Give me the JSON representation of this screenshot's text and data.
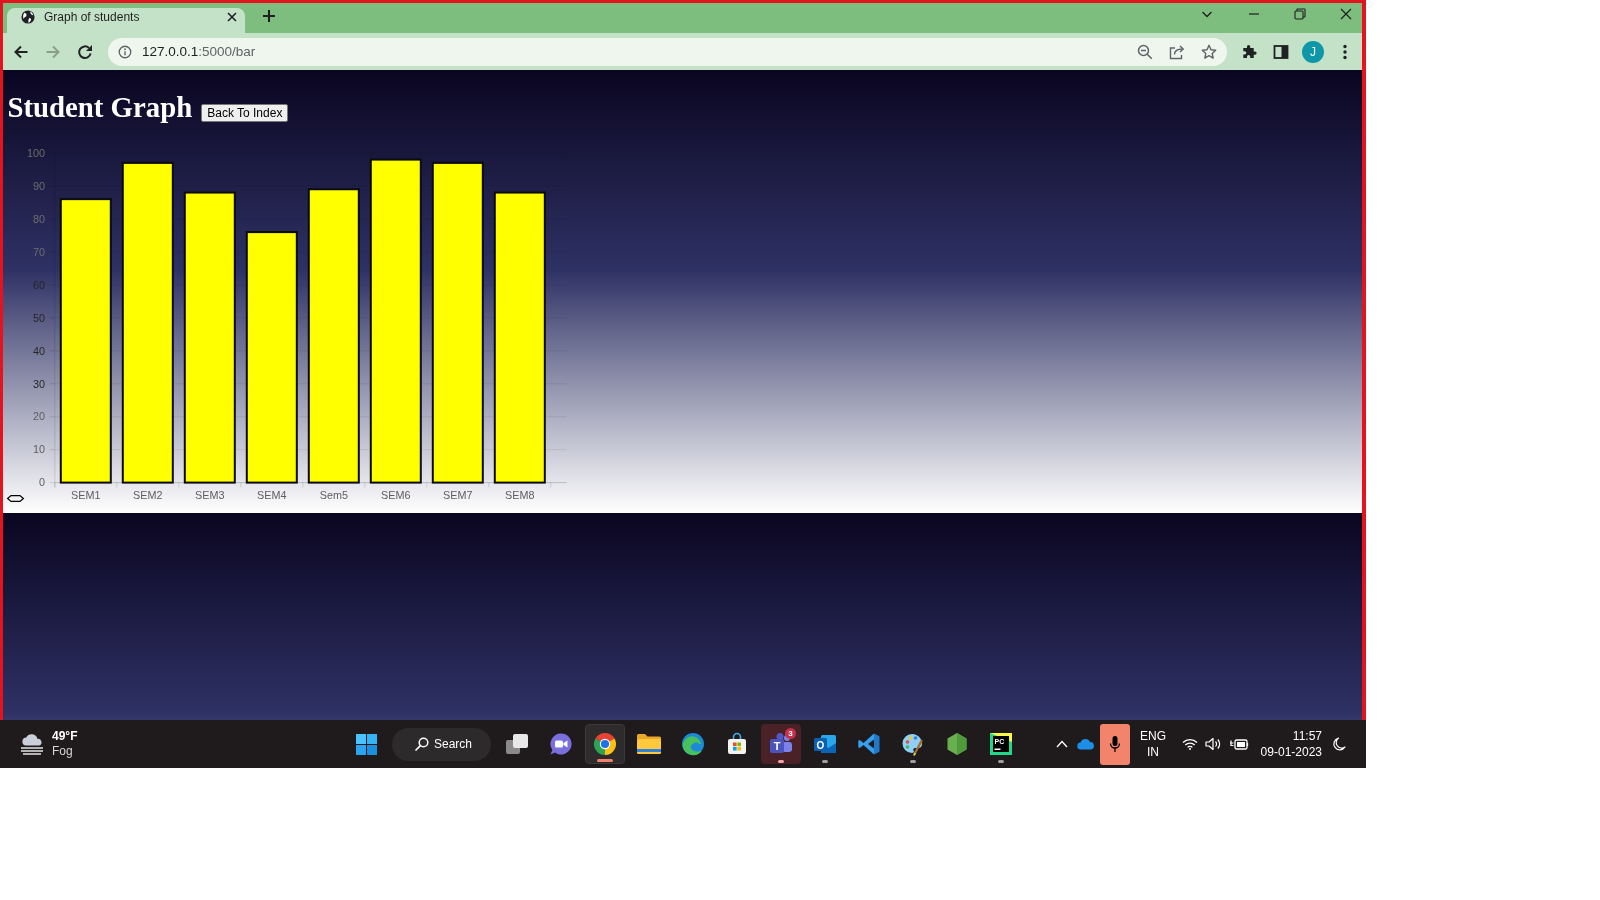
{
  "browser": {
    "tabs": [
      {
        "title": "Graph of students",
        "selected": true
      }
    ],
    "nav_buttons": [
      {
        "kind": "back",
        "disabled": false
      },
      {
        "kind": "forward",
        "disabled": true
      },
      {
        "kind": "reload",
        "disabled": false
      }
    ],
    "address": {
      "host": "127.0.0.1",
      "path": ":5000/bar"
    },
    "profile_initial": "J"
  },
  "page": {
    "title": "Student Graph",
    "back_button": "Back To Index",
    "chart_data": [
      {
        "type": "bar",
        "categories": [
          "SEM1",
          "SEM2",
          "SEM3",
          "SEM4",
          "Sem5",
          "SEM6",
          "SEM7",
          "SEM8"
        ],
        "values": [
          86,
          97,
          88,
          76,
          89,
          98,
          97,
          88
        ],
        "color": "#ffff00",
        "ylim": [
          0,
          100
        ],
        "yticks": [
          0,
          10,
          20,
          30,
          40,
          50,
          60,
          70,
          80,
          90,
          100
        ],
        "grid": true
      }
    ]
  },
  "taskbar": {
    "weather": {
      "temperature": "49°F",
      "condition": "Fog"
    },
    "search": {
      "label": "Search"
    },
    "apps": [
      {
        "kind": "task-view",
        "running": false,
        "selected": false,
        "attention": false
      },
      {
        "kind": "video-chat",
        "running": false,
        "selected": false,
        "attention": false
      },
      {
        "kind": "chrome",
        "running": true,
        "selected": true,
        "attention": false
      },
      {
        "kind": "folder",
        "running": false,
        "selected": false,
        "attention": false
      },
      {
        "kind": "edge",
        "running": false,
        "selected": false,
        "attention": false
      },
      {
        "kind": "store",
        "running": false,
        "selected": false,
        "attention": false
      },
      {
        "kind": "teams",
        "running": true,
        "selected": false,
        "attention": true,
        "badge": "3",
        "logo_text": "T"
      },
      {
        "kind": "outlook",
        "running": true,
        "selected": false,
        "attention": false,
        "logo_text": "O"
      },
      {
        "kind": "vscode",
        "running": false,
        "selected": false,
        "attention": false
      },
      {
        "kind": "paint",
        "running": true,
        "selected": false,
        "attention": false
      },
      {
        "kind": "hexagon",
        "running": false,
        "selected": false,
        "attention": false
      },
      {
        "kind": "pycharm",
        "running": true,
        "selected": false,
        "attention": false,
        "logo_text": "PC"
      }
    ],
    "tray": {
      "mic_in_use": true,
      "language": "ENG",
      "region": "IN",
      "time": "11:57",
      "date": "09-01-2023"
    }
  }
}
